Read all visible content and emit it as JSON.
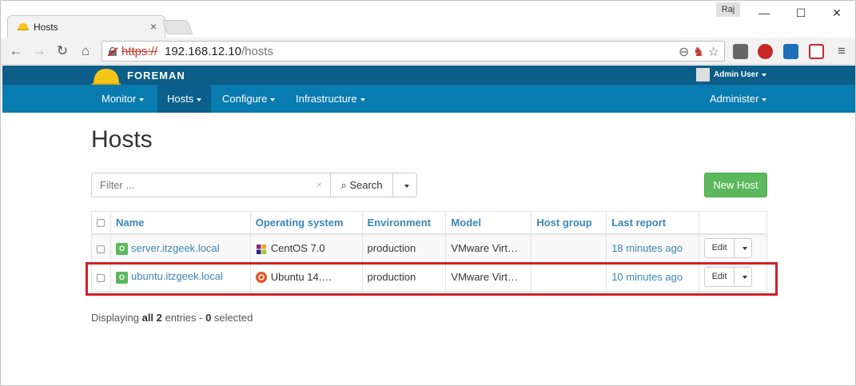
{
  "browser": {
    "tab_title": "Hosts",
    "profile_name": "Raj",
    "url_scheme": "https://",
    "url_host": "192.168.12.10",
    "url_path": "/hosts"
  },
  "foreman": {
    "brand": "FOREMAN",
    "user": "Admin User",
    "nav": [
      {
        "label": "Monitor"
      },
      {
        "label": "Hosts"
      },
      {
        "label": "Configure"
      },
      {
        "label": "Infrastructure"
      }
    ],
    "admin": "Administer"
  },
  "page": {
    "title": "Hosts",
    "filter_placeholder": "Filter ...",
    "search_label": "Search",
    "new_host_label": "New Host"
  },
  "table": {
    "columns": [
      "Name",
      "Operating system",
      "Environment",
      "Model",
      "Host group",
      "Last report"
    ],
    "rows": [
      {
        "status": "O",
        "name": "server.itzgeek.local",
        "os": "CentOS 7.0",
        "environment": "production",
        "model": "VMware Virt…",
        "host_group": "",
        "last_report": "18 minutes ago",
        "edit": "Edit"
      },
      {
        "status": "O",
        "name": "ubuntu.itzgeek.local",
        "os": "Ubuntu 14.…",
        "environment": "production",
        "model": "VMware Virt…",
        "host_group": "",
        "last_report": "10 minutes ago",
        "edit": "Edit"
      }
    ]
  },
  "footer": {
    "prefix": "Displaying ",
    "all": "all 2",
    "middle": " entries - ",
    "selected": "0",
    "suffix": " selected"
  },
  "colors": {
    "topbar": "#0c5e88",
    "navbar": "#087bb0",
    "link": "#3b86b6",
    "success": "#5cb85c",
    "highlight": "#d0202a"
  }
}
